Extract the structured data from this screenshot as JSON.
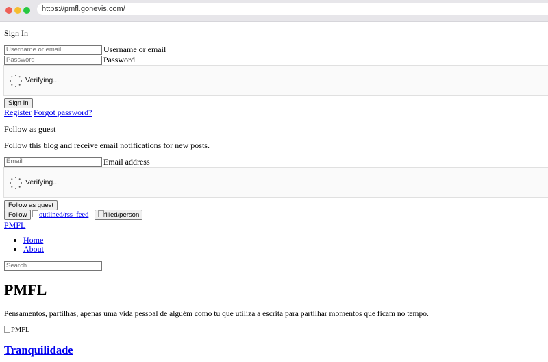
{
  "browser": {
    "url": "https://pmfl.gonevis.com/"
  },
  "signin": {
    "heading": "Sign In",
    "username_placeholder": "Username or email",
    "username_label": "Username or email",
    "password_placeholder": "Password",
    "password_label": "Password",
    "verifying": "Verifying...",
    "button": "Sign In",
    "register_link": "Register",
    "forgot_link": "Forgot password?"
  },
  "guest": {
    "heading": "Follow as guest",
    "description": "Follow this blog and receive email notifications for new posts.",
    "email_placeholder": "Email",
    "email_label": "Email address",
    "verifying": "Verifying...",
    "button": "Follow as guest"
  },
  "toolbar": {
    "follow_button": "Follow",
    "rss_alt": "outlined/rss_feed",
    "person_alt": "filled/person"
  },
  "site": {
    "brand_link": "PMFL",
    "nav": [
      "Home",
      "About"
    ],
    "search_placeholder": "Search",
    "title": "PMFL",
    "description": "Pensamentos, partilhas, apenas uma vida pessoal de alguém como tu que utiliza a escrita para partilhar momentos que ficam no tempo.",
    "cover_alt": "PMFL"
  },
  "posts": [
    {
      "title": "Tranquilidade"
    }
  ]
}
